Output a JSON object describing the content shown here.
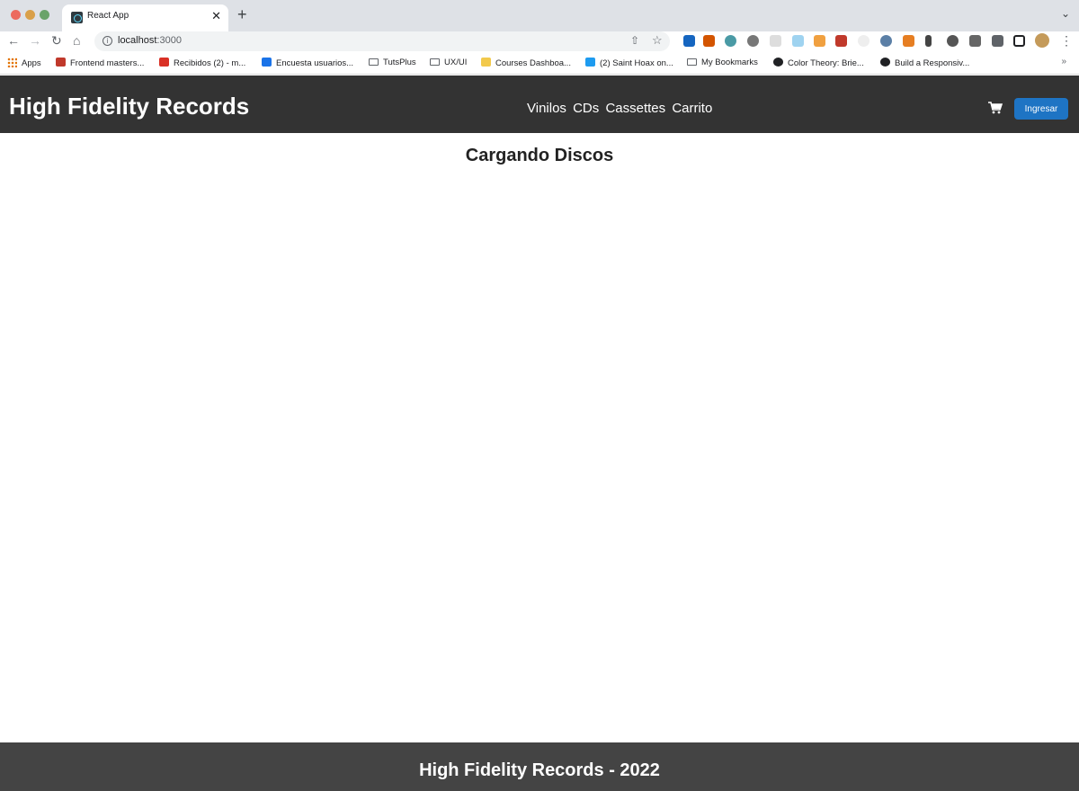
{
  "browser": {
    "tab_title": "React App",
    "url_host": "localhost",
    "url_port": ":3000",
    "bookmarks": [
      {
        "label": "Apps",
        "icon": "apps-grid-icon",
        "color": "#e37400"
      },
      {
        "label": "Frontend masters...",
        "icon": "frontend-masters-icon",
        "color": "#c0392b"
      },
      {
        "label": "Recibidos (2) - m...",
        "icon": "gmail-icon",
        "color": "#d93025"
      },
      {
        "label": "Encuesta usuarios...",
        "icon": "forms-icon",
        "color": "#1a73e8"
      },
      {
        "label": "TutsPlus",
        "icon": "folder-icon",
        "color": "#5f6368"
      },
      {
        "label": "UX/UI",
        "icon": "folder-icon",
        "color": "#5f6368"
      },
      {
        "label": "Courses Dashboa...",
        "icon": "crown-icon",
        "color": "#f2c94c"
      },
      {
        "label": "(2) Saint Hoax on...",
        "icon": "twitter-icon",
        "color": "#1d9bf0"
      },
      {
        "label": "My Bookmarks",
        "icon": "folder-icon",
        "color": "#5f6368"
      },
      {
        "label": "Color Theory: Brie...",
        "icon": "color-theory-icon",
        "color": "#202124"
      },
      {
        "label": "Build a Responsiv...",
        "icon": "build-icon",
        "color": "#202124"
      }
    ],
    "more_bookmarks": "»"
  },
  "header": {
    "brand": "High Fidelity Records",
    "nav": [
      "Vinilos",
      "CDs",
      "Cassettes",
      "Carrito"
    ],
    "login_label": "Ingresar"
  },
  "main": {
    "loading_text": "Cargando Discos"
  },
  "footer": {
    "text": "High Fidelity Records - 2022"
  },
  "colors": {
    "header_bg": "#333333",
    "footer_bg": "#444444",
    "login_bg": "#1e74c4"
  }
}
